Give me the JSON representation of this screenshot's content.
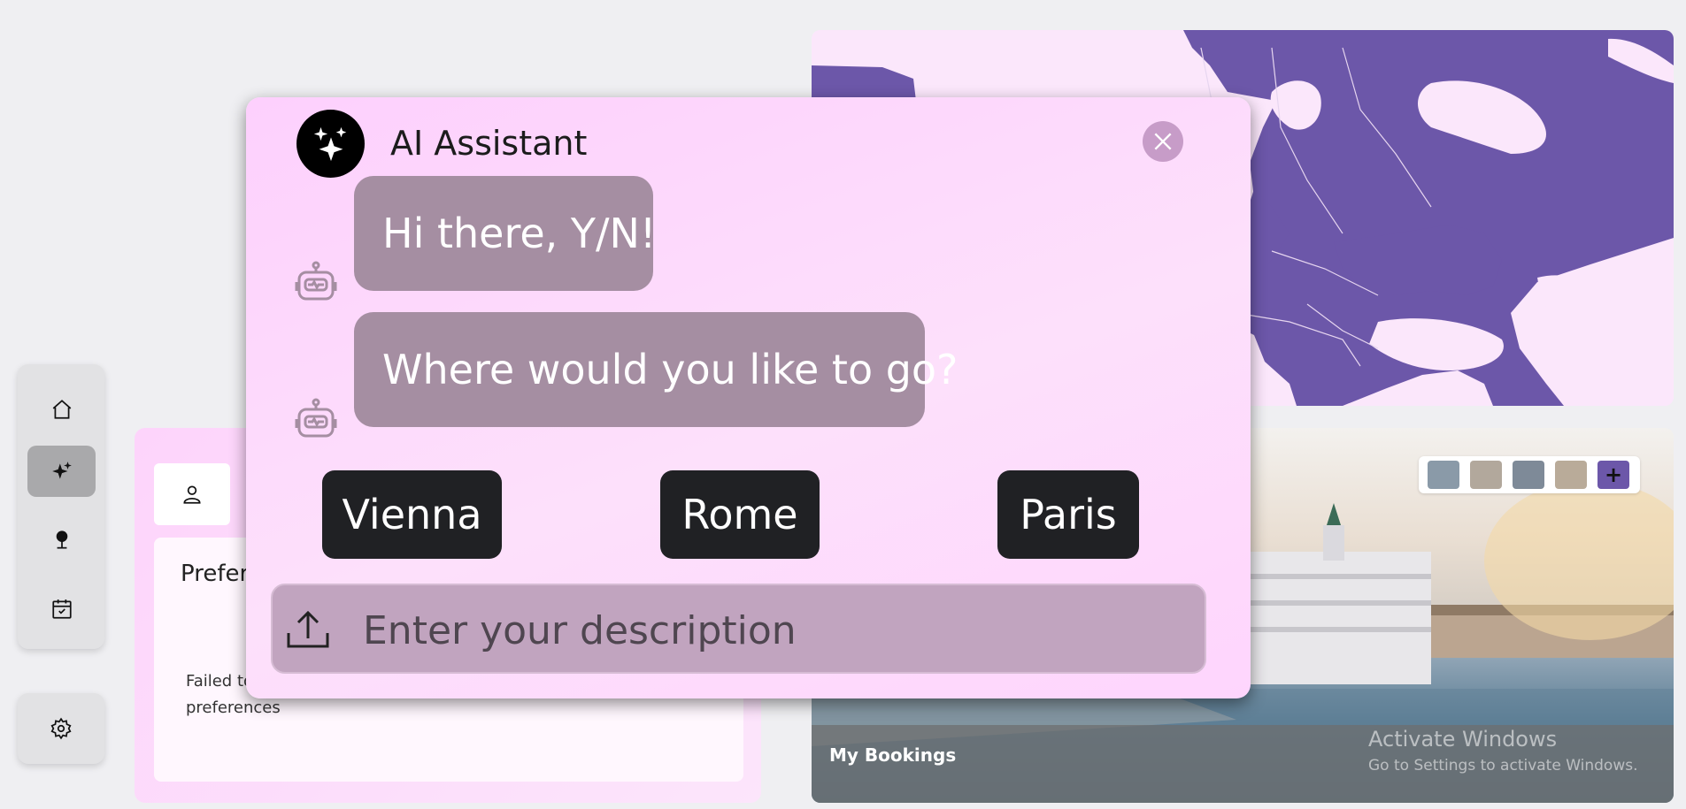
{
  "sidebar": {
    "items": [
      {
        "icon": "home-icon"
      },
      {
        "icon": "sparkles-icon",
        "active": true
      },
      {
        "icon": "map-pin-icon"
      },
      {
        "icon": "calendar-check-icon"
      }
    ],
    "settings_icon": "gear-icon"
  },
  "preferences": {
    "tab_icon": "user-icon",
    "title": "Prefer",
    "message": "Failed to preferences"
  },
  "map": {
    "fill_color": "#6c57a9",
    "land_color": "#fbe7fb"
  },
  "hotel": {
    "thumbnail_count": 4,
    "add_label": "+",
    "bookings_label": "My Bookings"
  },
  "watermark": {
    "title": "Activate Windows",
    "subtitle": "Go to Settings to activate Windows."
  },
  "assistant": {
    "title": "AI Assistant",
    "messages": [
      {
        "sender": "bot",
        "text": "Hi there, Y/N!"
      },
      {
        "sender": "bot",
        "text": "Where would you like to go?"
      }
    ],
    "choices": [
      "Vienna",
      "Rome",
      "Paris"
    ],
    "input": {
      "placeholder": "Enter your description",
      "value": ""
    }
  },
  "colors": {
    "modal_bg": "#fdd3fc",
    "bubble": "#a58ea2",
    "choice": "#202124",
    "input": "#c1a4bf",
    "close": "#c79cc8"
  }
}
